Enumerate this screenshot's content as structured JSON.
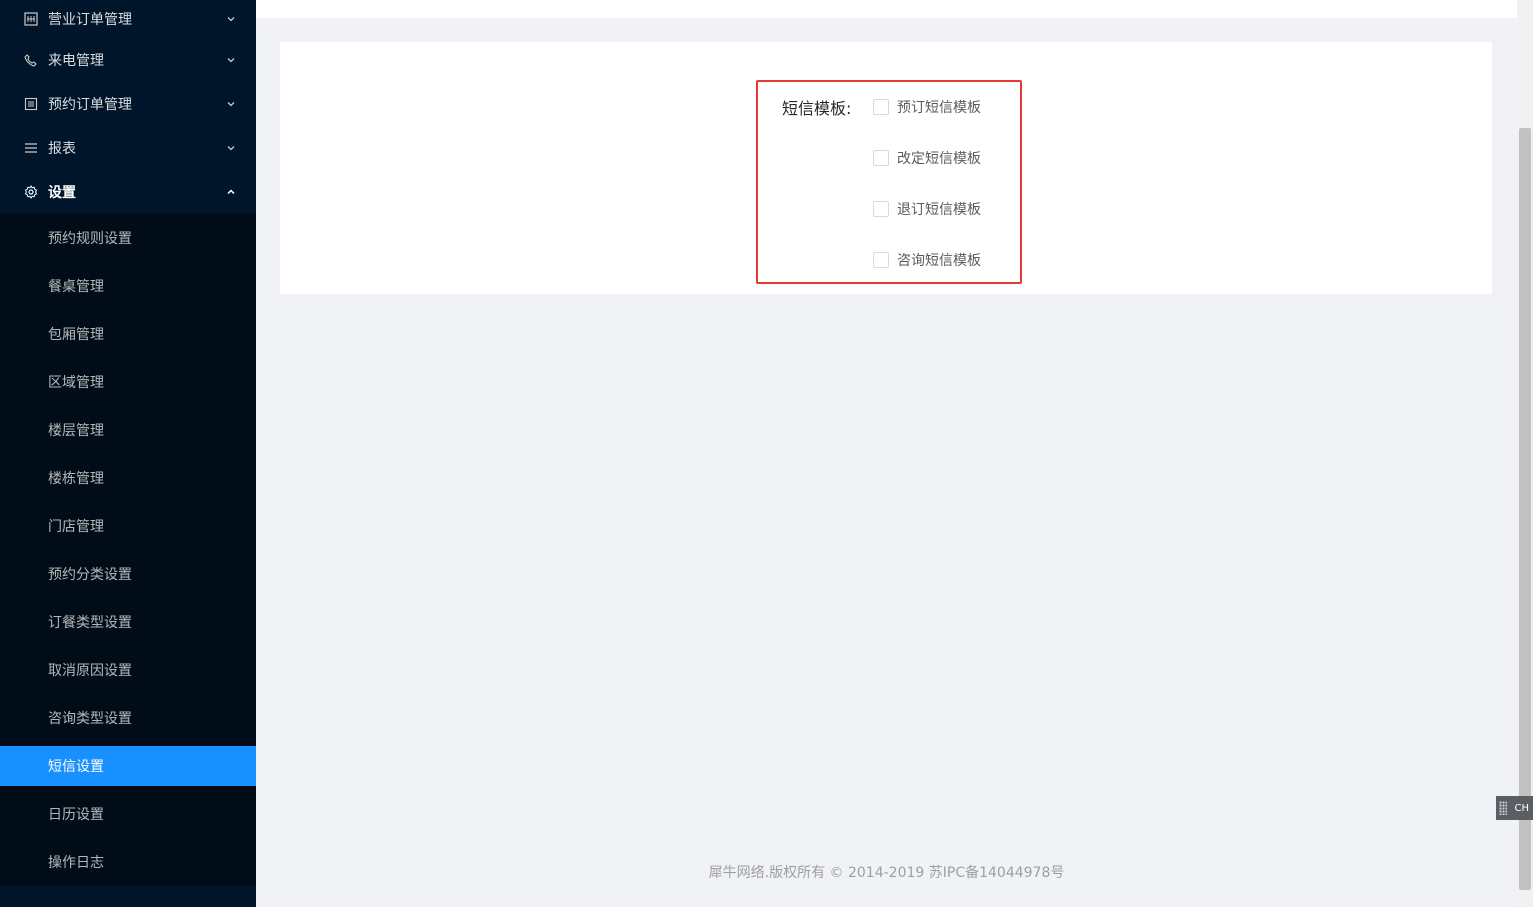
{
  "sidebar": {
    "menus": [
      {
        "label": "营业订单管理",
        "icon": "order-icon"
      },
      {
        "label": "来电管理",
        "icon": "phone-icon"
      },
      {
        "label": "预约订单管理",
        "icon": "list-icon"
      },
      {
        "label": "报表",
        "icon": "menu-lines-icon"
      },
      {
        "label": "设置",
        "icon": "gear-icon"
      }
    ],
    "settings_items": [
      "预约规则设置",
      "餐桌管理",
      "包厢管理",
      "区域管理",
      "楼层管理",
      "楼栋管理",
      "门店管理",
      "预约分类设置",
      "订餐类型设置",
      "取消原因设置",
      "咨询类型设置",
      "短信设置",
      "日历设置",
      "操作日志"
    ],
    "active_item": "短信设置"
  },
  "form": {
    "label": "短信模板:",
    "options": [
      "预订短信模板",
      "改定短信模板",
      "退订短信模板",
      "咨询短信模板"
    ]
  },
  "footer": {
    "text": "犀牛网络.版权所有 © 2014-2019 苏IPC备14044978号"
  },
  "ime": {
    "text": "CH"
  },
  "colors": {
    "sidebar_bg": "#001529",
    "submenu_bg": "#000c17",
    "active": "#1890ff",
    "highlight": "#e53935"
  }
}
